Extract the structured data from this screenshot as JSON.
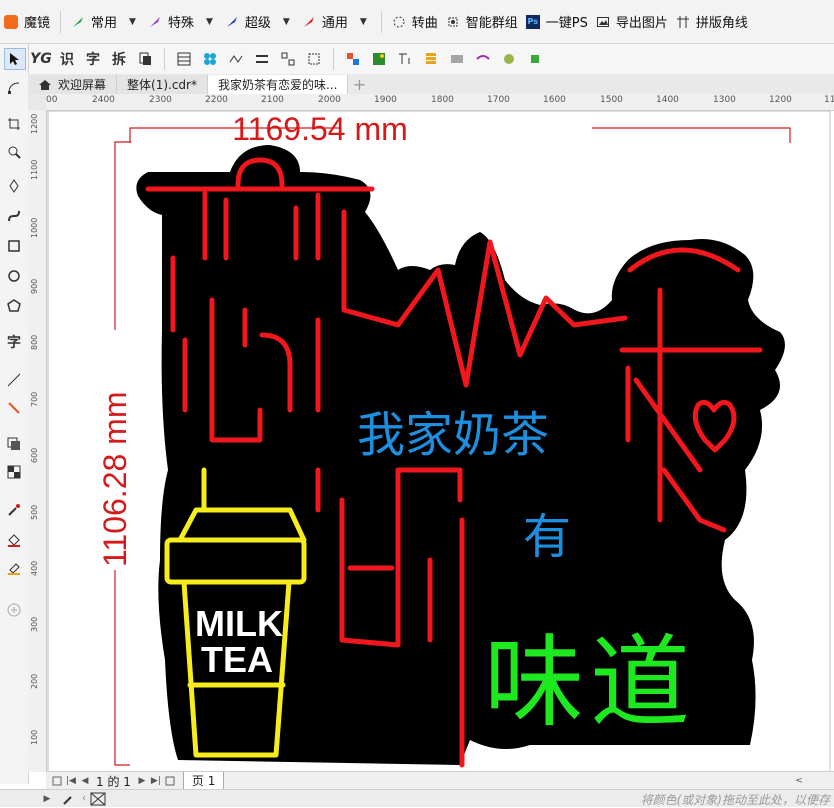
{
  "menubar": {
    "items": [
      {
        "label": "魔镜",
        "icon": "magic-mirror-icon"
      },
      {
        "label": "常用",
        "icon": "green-pen-icon"
      },
      {
        "label": "特殊",
        "icon": "purple-pen-icon"
      },
      {
        "label": "超级",
        "icon": "blue-pen-icon"
      },
      {
        "label": "通用",
        "icon": "red-pen-icon"
      },
      {
        "label": "转曲",
        "icon": "convert-curve-icon"
      },
      {
        "label": "智能群组",
        "icon": "smart-group-icon"
      },
      {
        "label": "一键PS",
        "icon": "ps-icon"
      },
      {
        "label": "导出图片",
        "icon": "export-image-icon"
      },
      {
        "label": "拼版角线",
        "icon": "crop-marks-icon"
      }
    ]
  },
  "toolbar2": {
    "text_buttons": [
      "YG",
      "识",
      "字",
      "拆"
    ]
  },
  "tabs": {
    "items": [
      {
        "label": "欢迎屏幕",
        "icon": "home-icon"
      },
      {
        "label": "整体(1).cdr*"
      },
      {
        "label": "我家奶茶有恋爱的味..."
      }
    ],
    "add_label": "+"
  },
  "rulers": {
    "h_ticks": [
      "00",
      "2400",
      "2300",
      "2200",
      "2100",
      "2000",
      "1900",
      "1800",
      "1700",
      "1600",
      "1500",
      "1400",
      "1300",
      "1200",
      "11"
    ],
    "v_ticks": [
      "1200",
      "1100",
      "1000",
      "900",
      "800",
      "700",
      "600",
      "500",
      "400",
      "300",
      "200",
      "100"
    ]
  },
  "artwork": {
    "width_dimension": "1169.54 mm",
    "height_dimension": "1106.28 mm",
    "blue_text_line1": "我家奶茶",
    "blue_text_line2": "有",
    "green_text": "味道",
    "cup_text_line1": "MILK",
    "cup_text_line2": "TEA",
    "colors": {
      "neon_red": "#f2161d",
      "neon_blue": "#1c8fe0",
      "neon_green": "#1ee81e",
      "neon_yellow": "#f7ec1c",
      "board": "#000000",
      "dimension": "#d61a1a"
    }
  },
  "pagebar": {
    "page_counter": "1 的 1",
    "page_tab": "页 1"
  },
  "statusbar": {
    "hint": "将颜色(或对象)拖动至此处，以便存"
  }
}
